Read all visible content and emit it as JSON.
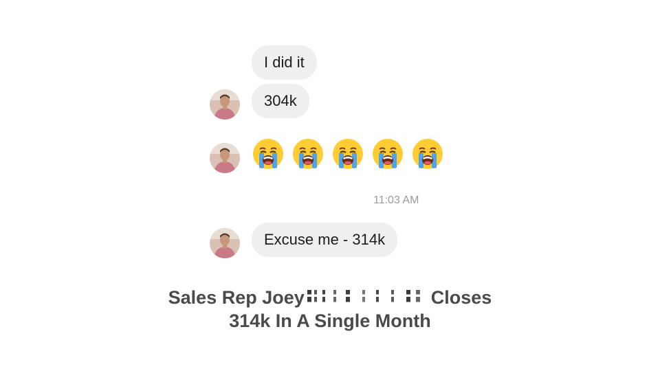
{
  "messages": [
    {
      "text": "I did it"
    },
    {
      "text": "304k"
    },
    {
      "text": "Excuse me - 314k"
    }
  ],
  "emoji_reaction": {
    "icon": "loudly-crying-face-icon",
    "count": 5
  },
  "timestamp": "11:03 AM",
  "caption": {
    "line1_prefix": "Sales Rep Joey",
    "line1_suffix": "Closes",
    "line2": "314k In A Single Month"
  },
  "colors": {
    "bubble_bg": "#efefef",
    "text": "#1c1c1c",
    "timestamp": "#9a9a9a",
    "caption": "#4a4a4a"
  }
}
